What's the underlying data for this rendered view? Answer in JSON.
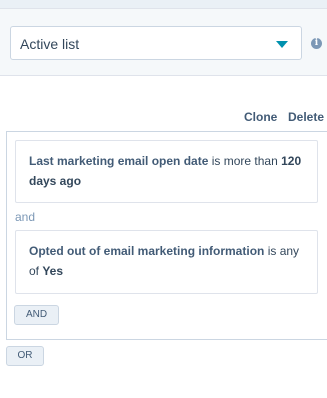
{
  "list_type": {
    "selected": "Active list",
    "icons": {
      "caret": "caret-down-icon",
      "info": "info-icon"
    }
  },
  "group": {
    "clone_label": "Clone",
    "delete_label": "Delete",
    "joiner": "and",
    "filters": [
      {
        "property": "Last marketing email open date",
        "operator": " is more than ",
        "value": "120 days ago"
      },
      {
        "property": "Opted out of email marketing information",
        "operator": " is any of ",
        "value": "Yes"
      }
    ],
    "and_button": "AND"
  },
  "or_button": "OR",
  "colors": {
    "accent": "#0091ae",
    "text": "#33475b",
    "link": "#425b76",
    "border": "#cbd6e2"
  }
}
